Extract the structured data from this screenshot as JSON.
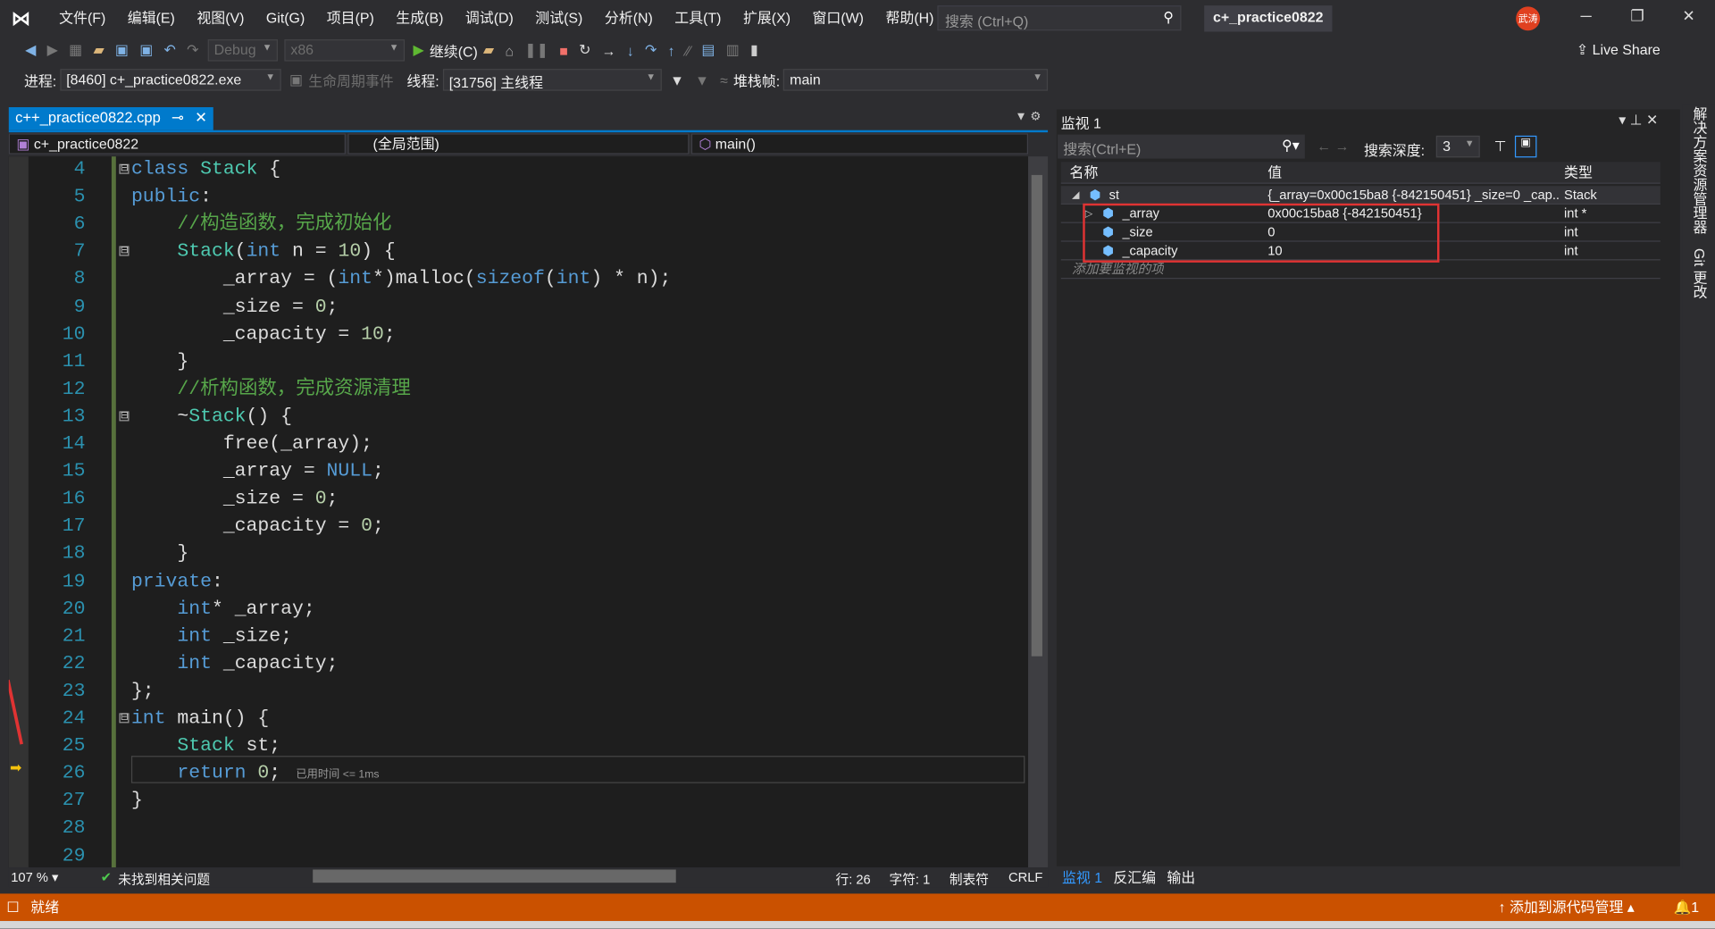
{
  "menubar": {
    "items": [
      "文件(F)",
      "编辑(E)",
      "视图(V)",
      "Git(G)",
      "项目(P)",
      "生成(B)",
      "调试(D)",
      "测试(S)",
      "分析(N)",
      "工具(T)",
      "扩展(X)",
      "窗口(W)",
      "帮助(H)"
    ],
    "search_placeholder": "搜索 (Ctrl+Q)",
    "solution_title": "c+_practice0822",
    "avatar": "武涛",
    "live_share": "Live Share"
  },
  "toolbar": {
    "config": "Debug",
    "platform": "x86",
    "continue": "继续(C)"
  },
  "debugbar": {
    "process_label": "进程:",
    "process": "[8460] c+_practice0822.exe",
    "lifecycle": "生命周期事件",
    "thread_label": "线程:",
    "thread": "[31756] 主线程",
    "stack_label": "堆栈帧:",
    "stack": "main"
  },
  "editor": {
    "tab": "c++_practice0822.cpp",
    "nav_project": "c+_practice0822",
    "nav_scope": "(全局范围)",
    "nav_func": "main()",
    "hint": "已用时间 <= 1ms",
    "lines": [
      {
        "n": "4",
        "fold": "⊟",
        "tok": [
          [
            "class ",
            "k"
          ],
          [
            "Stack",
            "t"
          ],
          [
            " {",
            "p"
          ]
        ]
      },
      {
        "n": "5",
        "tok": [
          [
            "public",
            "k"
          ],
          [
            ":",
            "p"
          ]
        ]
      },
      {
        "n": "6",
        "tok": [
          [
            "    //构造函数，完成初始化",
            "c"
          ]
        ]
      },
      {
        "n": "7",
        "fold": "⊟",
        "tok": [
          [
            "    ",
            "p"
          ],
          [
            "Stack",
            "t"
          ],
          [
            "(",
            "p"
          ],
          [
            "int",
            "k"
          ],
          [
            " n = ",
            "p"
          ],
          [
            "10",
            "n"
          ],
          [
            ") {",
            "p"
          ]
        ]
      },
      {
        "n": "8",
        "tok": [
          [
            "        _array = (",
            "p"
          ],
          [
            "int",
            "k"
          ],
          [
            "*)malloc(",
            "p"
          ],
          [
            "sizeof",
            "k"
          ],
          [
            "(",
            "p"
          ],
          [
            "int",
            "k"
          ],
          [
            ") * n);",
            "p"
          ]
        ]
      },
      {
        "n": "9",
        "tok": [
          [
            "        _size = ",
            "p"
          ],
          [
            "0",
            "n"
          ],
          [
            ";",
            "p"
          ]
        ]
      },
      {
        "n": "10",
        "tok": [
          [
            "        _capacity = ",
            "p"
          ],
          [
            "10",
            "n"
          ],
          [
            ";",
            "p"
          ]
        ]
      },
      {
        "n": "11",
        "tok": [
          [
            "    }",
            "p"
          ]
        ]
      },
      {
        "n": "12",
        "tok": [
          [
            "    //析构函数，完成资源清理",
            "c"
          ]
        ]
      },
      {
        "n": "13",
        "fold": "⊟",
        "tok": [
          [
            "    ~",
            "p"
          ],
          [
            "Stack",
            "t"
          ],
          [
            "() {",
            "p"
          ]
        ]
      },
      {
        "n": "14",
        "tok": [
          [
            "        free(_array);",
            "p"
          ]
        ]
      },
      {
        "n": "15",
        "tok": [
          [
            "        _array = ",
            "p"
          ],
          [
            "NULL",
            "k"
          ],
          [
            ";",
            "p"
          ]
        ]
      },
      {
        "n": "16",
        "tok": [
          [
            "        _size = ",
            "p"
          ],
          [
            "0",
            "n"
          ],
          [
            ";",
            "p"
          ]
        ]
      },
      {
        "n": "17",
        "tok": [
          [
            "        _capacity = ",
            "p"
          ],
          [
            "0",
            "n"
          ],
          [
            ";",
            "p"
          ]
        ]
      },
      {
        "n": "18",
        "tok": [
          [
            "    }",
            "p"
          ]
        ]
      },
      {
        "n": "19",
        "tok": [
          [
            "private",
            "k"
          ],
          [
            ":",
            "p"
          ]
        ]
      },
      {
        "n": "20",
        "tok": [
          [
            "    ",
            "p"
          ],
          [
            "int",
            "k"
          ],
          [
            "* _array;",
            "p"
          ]
        ]
      },
      {
        "n": "21",
        "tok": [
          [
            "    ",
            "p"
          ],
          [
            "int",
            "k"
          ],
          [
            " _size;",
            "p"
          ]
        ]
      },
      {
        "n": "22",
        "tok": [
          [
            "    ",
            "p"
          ],
          [
            "int",
            "k"
          ],
          [
            " _capacity;",
            "p"
          ]
        ]
      },
      {
        "n": "23",
        "tok": [
          [
            "};",
            "p"
          ]
        ]
      },
      {
        "n": "24",
        "fold": "⊟",
        "tok": [
          [
            "int",
            "k"
          ],
          [
            " main() {",
            "p"
          ]
        ]
      },
      {
        "n": "25",
        "tok": [
          [
            "    ",
            "p"
          ],
          [
            "Stack",
            "t"
          ],
          [
            " st;",
            "p"
          ]
        ]
      },
      {
        "n": "26",
        "tok": [
          [
            "    ",
            "p"
          ],
          [
            "return",
            "k"
          ],
          [
            " ",
            "p"
          ],
          [
            "0",
            "n"
          ],
          [
            ";",
            "p"
          ]
        ]
      },
      {
        "n": "27",
        "tok": [
          [
            "}",
            "p"
          ]
        ]
      },
      {
        "n": "28",
        "tok": []
      },
      {
        "n": "29",
        "tok": []
      }
    ]
  },
  "editor_status": {
    "zoom": "107 %",
    "issues": "未找到相关问题",
    "line": "行: 26",
    "char": "字符: 1",
    "tabs": "制表符",
    "eol": "CRLF"
  },
  "watch": {
    "title": "监视 1",
    "search_placeholder": "搜索(Ctrl+E)",
    "depth_label": "搜索深度:",
    "depth": "3",
    "headers": [
      "名称",
      "值",
      "类型"
    ],
    "rows": [
      {
        "name": "st",
        "value": "{_array=0x00c15ba8 {-842150451} _size=0 _cap...",
        "type": "Stack",
        "expander": "◢",
        "indent": 0
      },
      {
        "name": "_array",
        "value": "0x00c15ba8 {-842150451}",
        "type": "int *",
        "expander": "▷",
        "indent": 1
      },
      {
        "name": "_size",
        "value": "0",
        "type": "int",
        "expander": "",
        "indent": 1
      },
      {
        "name": "_capacity",
        "value": "10",
        "type": "int",
        "expander": "",
        "indent": 1
      }
    ],
    "add_placeholder": "添加要监视的项",
    "bottom_tabs": [
      "监视 1",
      "反汇编",
      "输出"
    ]
  },
  "side_tabs": [
    "解决方案资源管理器",
    "Git 更改"
  ],
  "statusbar": {
    "ready": "就绪",
    "source_control": "添加到源代码管理",
    "notifications": "1",
    "accent": "#ca5100"
  }
}
